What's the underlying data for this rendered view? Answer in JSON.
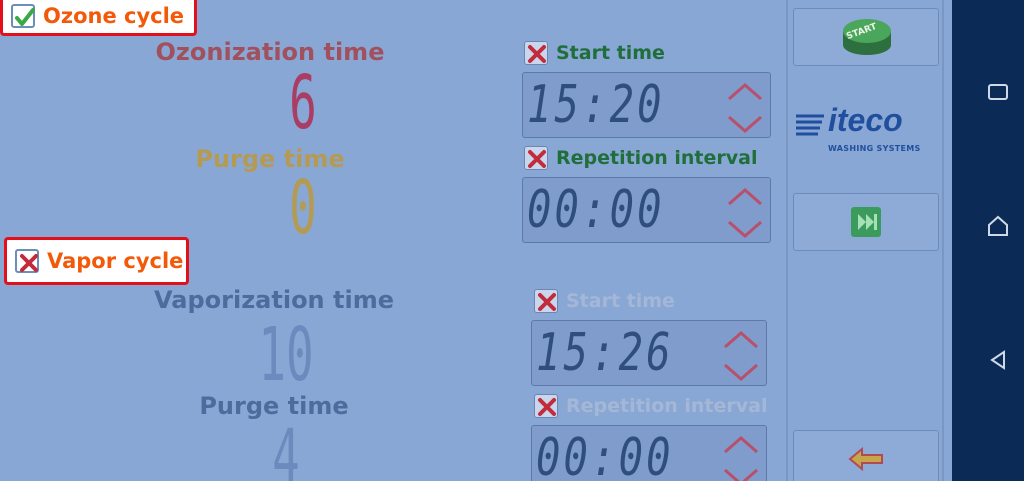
{
  "ozone": {
    "header": "Ozone cycle",
    "checked": true,
    "ozonization_label": "Ozonization time",
    "ozonization_value": "6",
    "purge_label": "Purge time",
    "purge_value": "0",
    "start_time_label": "Start time",
    "start_time_value": "15:20",
    "repetition_label": "Repetition interval",
    "repetition_value": "00:00"
  },
  "vapor": {
    "header": "Vapor cycle",
    "checked": false,
    "vaporization_label": "Vaporization time",
    "vaporization_value": "10",
    "purge_label": "Purge time",
    "purge_value": "4",
    "start_time_label": "Start time",
    "start_time_value": "15:26",
    "repetition_label": "Repetition interval",
    "repetition_value": "00:00"
  },
  "sidebar": {
    "start_label": "START",
    "logo_text": "iteco",
    "logo_sub": "WASHING SYSTEMS"
  },
  "colors": {
    "header_text": "#f25a0a",
    "header_border": "#e3101c",
    "ozonization": "#a1505e",
    "purge_ozone": "#b59a52",
    "vapor_labels": "#4d6c9d",
    "start_green": "#1f6e3b"
  },
  "icons": {
    "check": "check-icon",
    "cross": "cross-icon",
    "up": "chevron-up-icon",
    "down": "chevron-down-icon",
    "skip": "skip-forward-icon",
    "back": "back-arrow-icon",
    "nav_recent": "recent-apps-icon",
    "nav_home": "home-icon",
    "nav_back": "nav-back-icon"
  }
}
